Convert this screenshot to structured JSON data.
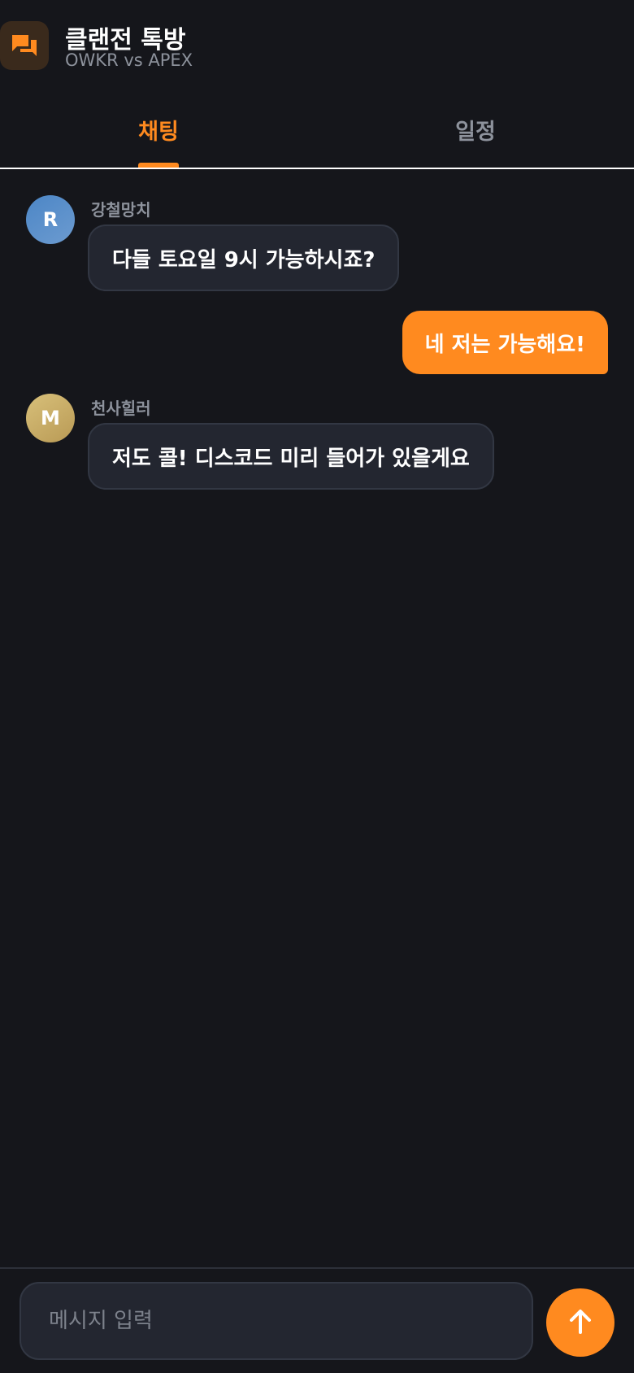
{
  "header": {
    "title": "클랜전 톡방",
    "subtitle": "OWKR vs APEX",
    "icon": "chat-bubbles-icon"
  },
  "tabs": [
    {
      "label": "채팅",
      "active": true
    },
    {
      "label": "일정",
      "active": false
    }
  ],
  "messages": [
    {
      "sender": "강철망치",
      "avatar": "R",
      "text": "다들 토요일 9시 가능하시죠?",
      "direction": "incoming"
    },
    {
      "sender": "",
      "text": "네 저는 가능해요!",
      "direction": "outgoing"
    },
    {
      "sender": "천사힐러",
      "avatar": "M",
      "text": "저도 콜! 디스코드 미리 들어가 있을게요",
      "direction": "incoming"
    }
  ],
  "composer": {
    "placeholder": "메시지 입력",
    "send_icon": "arrow-up-icon"
  },
  "colors": {
    "accent": "#ff8a1f",
    "background": "#15161b",
    "bubble": "#232630"
  }
}
